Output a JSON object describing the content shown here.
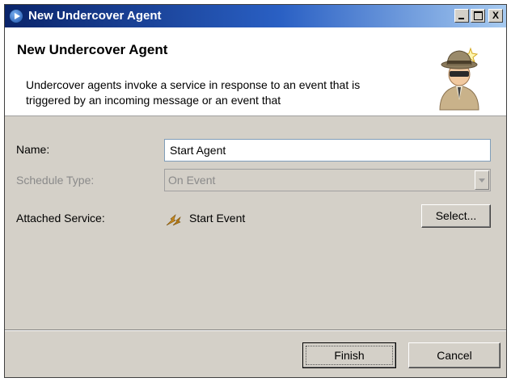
{
  "window": {
    "title": "New Undercover Agent",
    "controls": {
      "minimize": "_",
      "maximize": "□",
      "close": "X"
    }
  },
  "banner": {
    "title": "New Undercover Agent",
    "description": "Undercover agents invoke a service in response to an event that is triggered by an incoming message or an event that",
    "icon": "undercover-agent-icon"
  },
  "form": {
    "name_label": "Name:",
    "name_value": "Start Agent",
    "schedule_type_label": "Schedule Type:",
    "schedule_type_value": "On Event",
    "schedule_type_enabled": false,
    "attached_service_label": "Attached Service:",
    "attached_service_value": "Start Event",
    "attached_service_icon": "start-event-icon",
    "select_button": "Select..."
  },
  "footer": {
    "finish_button": "Finish",
    "cancel_button": "Cancel"
  },
  "colors": {
    "titlebar_start": "#0a246a",
    "titlebar_end": "#a6caf0",
    "dialog_bg": "#d4d0c8",
    "disabled_text": "#8a8a8a"
  }
}
